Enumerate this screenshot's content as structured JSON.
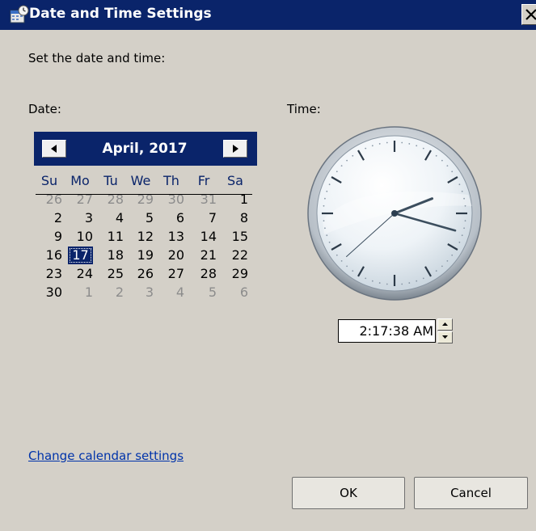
{
  "window": {
    "title": "Date and Time Settings",
    "icon": "calendar-clock-icon",
    "close_icon": "close-icon"
  },
  "instruction": "Set the date and time:",
  "date_label": "Date:",
  "time_label": "Time:",
  "calendar": {
    "month_label": "April, 2017",
    "prev_icon": "triangle-left-icon",
    "next_icon": "triangle-right-icon",
    "weekdays": [
      "Su",
      "Mo",
      "Tu",
      "We",
      "Th",
      "Fr",
      "Sa"
    ],
    "weeks": [
      [
        "26",
        "27",
        "28",
        "29",
        "30",
        "31",
        "1"
      ],
      [
        "2",
        "3",
        "4",
        "5",
        "6",
        "7",
        "8"
      ],
      [
        "9",
        "10",
        "11",
        "12",
        "13",
        "14",
        "15"
      ],
      [
        "16",
        "17",
        "18",
        "19",
        "20",
        "21",
        "22"
      ],
      [
        "23",
        "24",
        "25",
        "26",
        "27",
        "28",
        "29"
      ],
      [
        "30",
        "1",
        "2",
        "3",
        "4",
        "5",
        "6"
      ]
    ],
    "selected_day": "17",
    "colors": {
      "header_bg": "#0a246a",
      "selected_bg": "#0a246a",
      "other_month": "#8c8c8c"
    }
  },
  "clock": {
    "hour": 2,
    "minute": 17,
    "second": 38
  },
  "time_value": "2:17:38 AM",
  "link_text": "Change calendar settings",
  "buttons": {
    "ok": "OK",
    "cancel": "Cancel"
  }
}
